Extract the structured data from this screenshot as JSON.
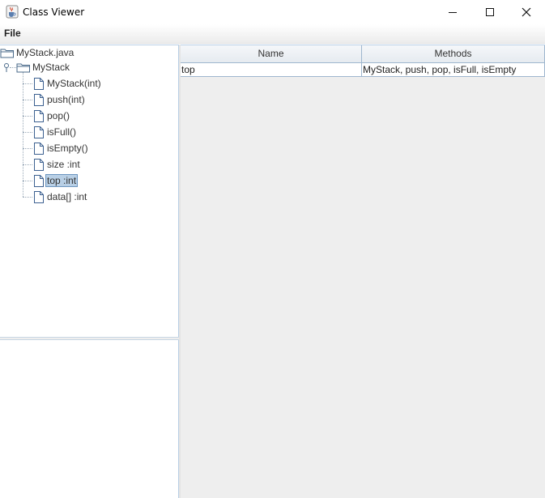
{
  "window": {
    "title": "Class Viewer",
    "icon": "java-cup-icon"
  },
  "menu": {
    "file_label": "File"
  },
  "tree": {
    "root": {
      "label": "MyStack.java",
      "icon": "folder-icon"
    },
    "class_node": {
      "label": "MyStack",
      "icon": "folder-icon",
      "expanded": true
    },
    "members": [
      {
        "label": "MyStack(int)",
        "icon": "file-icon",
        "selected": false
      },
      {
        "label": "push(int)",
        "icon": "file-icon",
        "selected": false
      },
      {
        "label": "pop()",
        "icon": "file-icon",
        "selected": false
      },
      {
        "label": "isFull()",
        "icon": "file-icon",
        "selected": false
      },
      {
        "label": "isEmpty()",
        "icon": "file-icon",
        "selected": false
      },
      {
        "label": "size :int",
        "icon": "file-icon",
        "selected": false
      },
      {
        "label": "top :int",
        "icon": "file-icon",
        "selected": true
      },
      {
        "label": "data[] :int",
        "icon": "file-icon",
        "selected": false
      }
    ]
  },
  "table": {
    "columns": [
      "Name",
      "Methods"
    ],
    "rows": [
      [
        "top",
        "MyStack, push, pop, isFull, isEmpty"
      ]
    ]
  },
  "colors": {
    "selection_bg": "#b8cfe5",
    "selection_border": "#6c95c0",
    "grid_line": "#9eb6ce",
    "table_bg": "#eeeeee"
  }
}
